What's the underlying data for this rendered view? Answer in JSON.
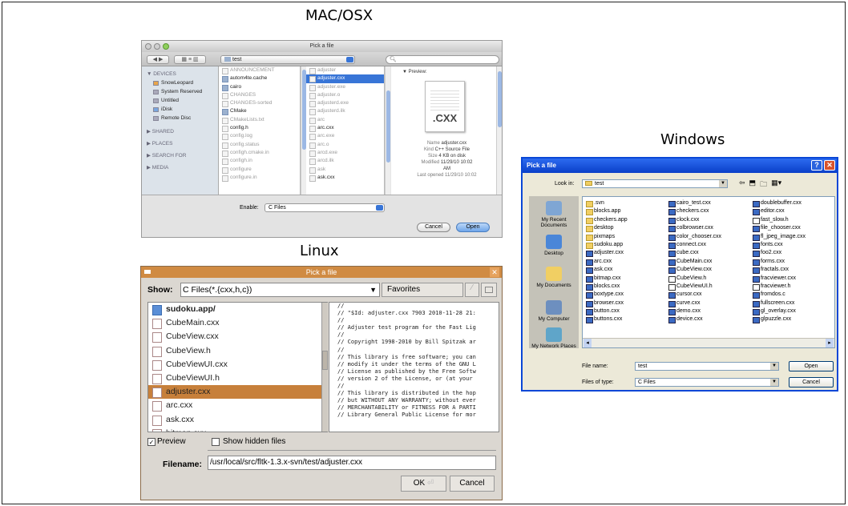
{
  "captions": {
    "mac": "MAC/OSX",
    "windows": "Windows",
    "linux": "Linux"
  },
  "mac": {
    "title": "Pick a file",
    "path": "test",
    "search_placeholder": "",
    "sidebar": {
      "devices_header": "▼ DEVICES",
      "devices": [
        "SnowLeopard",
        "System Reserved",
        "Untitled",
        "iDisk",
        "Remote Disc"
      ],
      "shared": "▶ SHARED",
      "places": "▶ PLACES",
      "search_for": "▶ SEARCH FOR",
      "media": "▶ MEDIA"
    },
    "col1": [
      {
        "name": "ANNOUNCEMENT",
        "dim": true
      },
      {
        "name": "autom4te.cache",
        "dim": false,
        "folder": true
      },
      {
        "name": "cairo",
        "dim": false,
        "folder": true
      },
      {
        "name": "CHANGES",
        "dim": true
      },
      {
        "name": "CHANGES-sorted",
        "dim": true
      },
      {
        "name": "CMake",
        "dim": false,
        "folder": true
      },
      {
        "name": "CMakeLists.txt",
        "dim": true
      },
      {
        "name": "config.h",
        "dim": false
      },
      {
        "name": "config.log",
        "dim": true
      },
      {
        "name": "config.status",
        "dim": true
      },
      {
        "name": "configh.cmake.in",
        "dim": true
      },
      {
        "name": "configh.in",
        "dim": true
      },
      {
        "name": "configure",
        "dim": true
      },
      {
        "name": "configure.in",
        "dim": true
      }
    ],
    "col2": [
      {
        "name": "adjuster",
        "dim": true
      },
      {
        "name": "adjuster.cxx",
        "dim": false,
        "sel": true
      },
      {
        "name": "adjuster.exe",
        "dim": true
      },
      {
        "name": "adjuster.o",
        "dim": true
      },
      {
        "name": "adjusterd.exe",
        "dim": true
      },
      {
        "name": "adjusterd.ilk",
        "dim": true
      },
      {
        "name": "arc",
        "dim": true
      },
      {
        "name": "arc.cxx",
        "dim": false
      },
      {
        "name": "arc.exe",
        "dim": true
      },
      {
        "name": "arc.o",
        "dim": true
      },
      {
        "name": "arcd.exe",
        "dim": true
      },
      {
        "name": "arcd.ilk",
        "dim": true
      },
      {
        "name": "ask",
        "dim": true
      },
      {
        "name": "ask.cxx",
        "dim": false
      }
    ],
    "preview": {
      "header": "▼ Preview:",
      "ext": ".CXX",
      "name_label": "Name",
      "name": "adjuster.cxx",
      "kind_label": "Kind",
      "kind": "C++ Source File",
      "size_label": "Size",
      "size": "4 KB on disk",
      "modified_label": "Modified",
      "modified": "11/29/10 10:02",
      "modified2": "AM",
      "opened": "Last opened 11/29/10 10:02"
    },
    "enable_label": "Enable:",
    "enable_value": "C Files",
    "cancel": "Cancel",
    "open": "Open"
  },
  "linux": {
    "title": "Pick a file",
    "show_label": "Show:",
    "show_value": "C Files(*.{cxx,h,c})",
    "favorites": "Favorites",
    "files": [
      {
        "name": "sudoku.app/",
        "folder": true
      },
      {
        "name": "CubeMain.cxx"
      },
      {
        "name": "CubeView.cxx"
      },
      {
        "name": "CubeView.h"
      },
      {
        "name": "CubeViewUI.cxx"
      },
      {
        "name": "CubeViewUI.h"
      },
      {
        "name": "adjuster.cxx",
        "sel": true
      },
      {
        "name": "arc.cxx"
      },
      {
        "name": "ask.cxx"
      },
      {
        "name": "bitmap.cxx"
      }
    ],
    "preview_text": "//\n// \"$Id: adjuster.cxx 7903 2010-11-28 21:\n//\n// Adjuster test program for the Fast Lig\n//\n// Copyright 1998-2010 by Bill Spitzak ar\n//\n// This library is free software; you can\n// modify it under the terms of the GNU L\n// License as published by the Free Softw\n// version 2 of the License, or (at your\n//\n// This library is distributed in the hop\n// but WITHOUT ANY WARRANTY; without ever\n// MERCHANTABILITY or FITNESS FOR A PARTI\n// Library General Public License for mor",
    "preview_label": "Preview",
    "hidden_label": "Show hidden files",
    "filename_label": "Filename:",
    "filename_value": "/usr/local/src/fltk-1.3.x-svn/test/adjuster.cxx",
    "ok": "OK",
    "cancel": "Cancel"
  },
  "windows": {
    "title": "Pick a file",
    "help": "?",
    "close": "✕",
    "lookin_label": "Look in:",
    "lookin_value": "test",
    "places": [
      "My Recent Documents",
      "Desktop",
      "My Documents",
      "My Computer",
      "My Network Places"
    ],
    "col1": [
      {
        "name": ".svn",
        "folder": true
      },
      {
        "name": "blocks.app",
        "folder": true
      },
      {
        "name": "checkers.app",
        "folder": true
      },
      {
        "name": "desktop",
        "folder": true
      },
      {
        "name": "pixmaps",
        "folder": true
      },
      {
        "name": "sudoku.app",
        "folder": true
      },
      {
        "name": "adjuster.cxx"
      },
      {
        "name": "arc.cxx"
      },
      {
        "name": "ask.cxx"
      },
      {
        "name": "bitmap.cxx"
      },
      {
        "name": "blocks.cxx"
      },
      {
        "name": "boxtype.cxx"
      },
      {
        "name": "browser.cxx"
      },
      {
        "name": "button.cxx"
      },
      {
        "name": "buttons.cxx"
      }
    ],
    "col2": [
      {
        "name": "cairo_test.cxx"
      },
      {
        "name": "checkers.cxx"
      },
      {
        "name": "clock.cxx"
      },
      {
        "name": "colbrowser.cxx"
      },
      {
        "name": "color_chooser.cxx"
      },
      {
        "name": "connect.cxx"
      },
      {
        "name": "cube.cxx"
      },
      {
        "name": "CubeMain.cxx"
      },
      {
        "name": "CubeView.cxx"
      },
      {
        "name": "CubeView.h",
        "h": true
      },
      {
        "name": "CubeViewUI.h",
        "h": true
      },
      {
        "name": "cursor.cxx"
      },
      {
        "name": "curve.cxx"
      },
      {
        "name": "demo.cxx"
      },
      {
        "name": "device.cxx"
      }
    ],
    "col3": [
      {
        "name": "doublebuffer.cxx"
      },
      {
        "name": "editor.cxx"
      },
      {
        "name": "fast_slow.h",
        "h": true
      },
      {
        "name": "file_chooser.cxx"
      },
      {
        "name": "fl_jpeg_image.cxx"
      },
      {
        "name": "fonts.cxx"
      },
      {
        "name": "foo2.cxx"
      },
      {
        "name": "forms.cxx"
      },
      {
        "name": "fractals.cxx"
      },
      {
        "name": "fracviewer.cxx"
      },
      {
        "name": "fracviewer.h",
        "h": true
      },
      {
        "name": "fromdos.c"
      },
      {
        "name": "fullscreen.cxx"
      },
      {
        "name": "gl_overlay.cxx"
      },
      {
        "name": "glpuzzle.cxx"
      }
    ],
    "filename_label": "File name:",
    "filename_value": "test",
    "filetype_label": "Files of type:",
    "filetype_value": "C Files",
    "open": "Open",
    "cancel": "Cancel"
  }
}
